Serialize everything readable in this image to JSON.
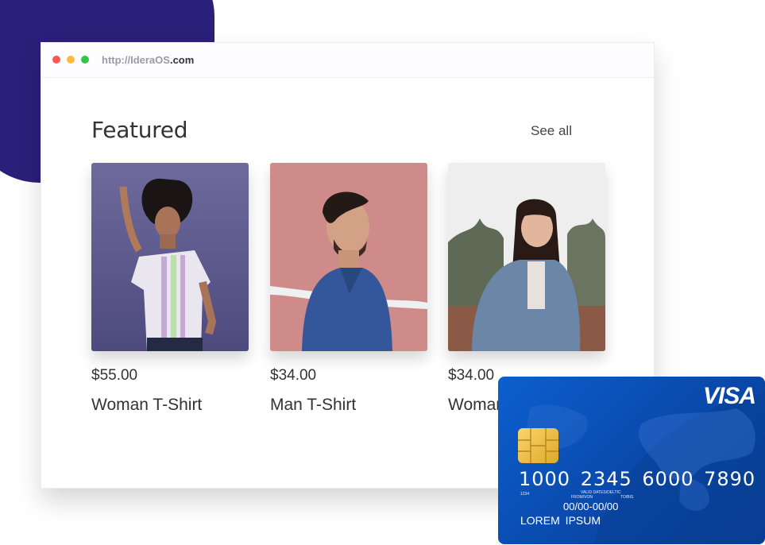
{
  "browser": {
    "url_prefix": "http://",
    "url_domain": "IderaOS",
    "url_suffix": ".com"
  },
  "section": {
    "title": "Featured",
    "see_all": "See all"
  },
  "products": [
    {
      "price": "$55.00",
      "name": "Woman T-Shirt"
    },
    {
      "price": "$34.00",
      "name": "Man T-Shirt"
    },
    {
      "price": "$34.00",
      "name": "Woman"
    }
  ],
  "credit_card": {
    "brand": "VISA",
    "number": "1000 2345 6000 7890",
    "small_code": "1234",
    "valid_label": "VALID DATES/DELTIC",
    "from_label": "FROM/VON",
    "to_label": "TO/BIS",
    "valid_dates": "00/00-00/00",
    "holder": "LOREM IPSUM"
  },
  "colors": {
    "accent_blob": "#2a2079",
    "card_blue": "#0a4cb0",
    "dot_red": "#fc5753",
    "dot_yellow": "#fdbc40",
    "dot_green": "#33c748"
  }
}
